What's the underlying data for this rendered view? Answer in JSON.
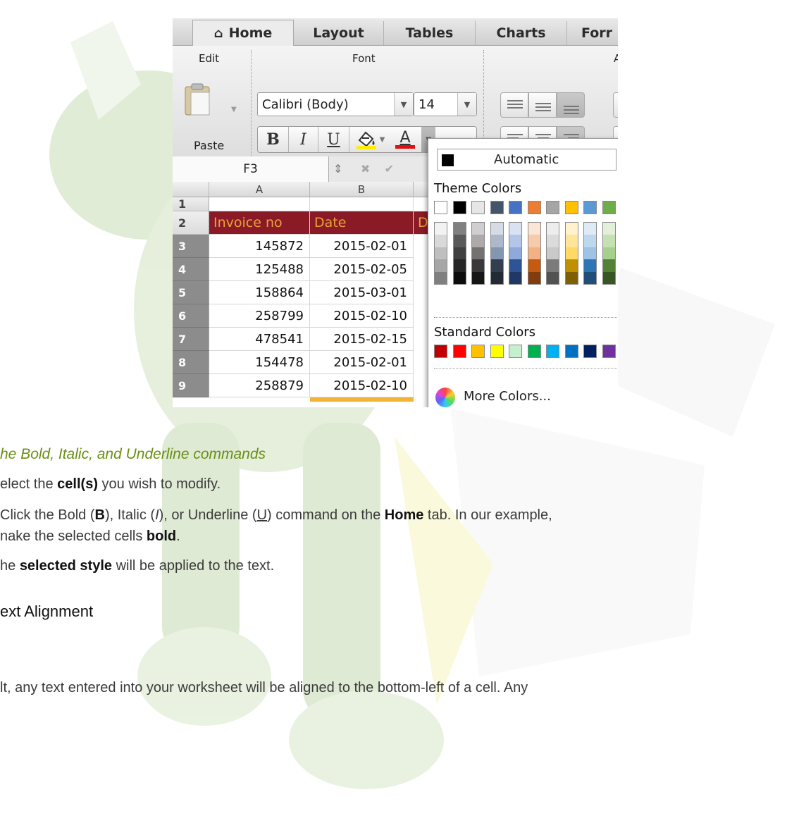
{
  "ribbon": {
    "tabs": [
      "Home",
      "Layout",
      "Tables",
      "Charts",
      "Forr"
    ],
    "groups": {
      "edit": "Edit",
      "font": "Font",
      "alignment_cut": "A"
    },
    "paste_label": "Paste",
    "font_name": "Calibri (Body)",
    "font_size": "14",
    "bold_label": "B",
    "italic_label": "I",
    "underline_label": "U",
    "highlight_color": "#ffee00",
    "font_color": "#e01010",
    "font_color_glyph": "A"
  },
  "namebox": "F3",
  "sheet": {
    "columns": [
      "A",
      "B"
    ],
    "row_numbers": [
      "1",
      "2",
      "3",
      "4",
      "5",
      "6",
      "7",
      "8",
      "9"
    ],
    "header_row": {
      "col_a": "Invoice no",
      "col_b": "Date",
      "col_c_cut": "D"
    },
    "rows": [
      {
        "invoice": "145872",
        "date": "2015-02-01"
      },
      {
        "invoice": "125488",
        "date": "2015-02-05"
      },
      {
        "invoice": "158864",
        "date": "2015-03-01"
      },
      {
        "invoice": "258799",
        "date": "2015-02-10"
      },
      {
        "invoice": "478541",
        "date": "2015-02-15"
      },
      {
        "invoice": "154478",
        "date": "2015-02-01"
      },
      {
        "invoice": "258879",
        "date": "2015-02-10"
      }
    ],
    "header_fill": "#8b1a27",
    "header_text_color": "#e8a33a"
  },
  "color_popup": {
    "automatic_label": "Automatic",
    "theme_label": "Theme Colors",
    "standard_label": "Standard Colors",
    "more_label": "More Colors...",
    "theme_top": [
      "#ffffff",
      "#000000",
      "#e7e6e6",
      "#44546a",
      "#4472c4",
      "#ed7d31",
      "#a5a5a5",
      "#ffc000",
      "#5b9bd5",
      "#70ad47"
    ],
    "theme_shades": [
      [
        "#f2f2f2",
        "#d9d9d9",
        "#bfbfbf",
        "#a6a6a6",
        "#808080"
      ],
      [
        "#808080",
        "#595959",
        "#404040",
        "#262626",
        "#0d0d0d"
      ],
      [
        "#d0cece",
        "#aeaaaa",
        "#757171",
        "#3a3838",
        "#171616"
      ],
      [
        "#d6dce4",
        "#adb9ca",
        "#8497b0",
        "#333f4f",
        "#222a35"
      ],
      [
        "#d9e2f3",
        "#b4c6e7",
        "#8eaadb",
        "#2f5496",
        "#1f3864"
      ],
      [
        "#fbe5d5",
        "#f7caac",
        "#f4b183",
        "#c55a11",
        "#833c0b"
      ],
      [
        "#ededed",
        "#dbdbdb",
        "#c9c9c9",
        "#7b7b7b",
        "#525252"
      ],
      [
        "#fff2cc",
        "#fee599",
        "#ffd966",
        "#bf9000",
        "#7f6000"
      ],
      [
        "#deebf6",
        "#bdd7ee",
        "#9dc3e6",
        "#2e75b5",
        "#1f4e79"
      ],
      [
        "#e2efd9",
        "#c5e0b3",
        "#a8d08d",
        "#538135",
        "#375623"
      ]
    ],
    "standard": [
      "#c00000",
      "#ff0000",
      "#ffc000",
      "#ffff00",
      "#c6efce",
      "#00b050",
      "#00b0f0",
      "#0070c0",
      "#002060",
      "#7030a0"
    ]
  },
  "doc": {
    "subhead": "he Bold, Italic, and Underline commands",
    "step1": {
      "t1": "elect the ",
      "b1": "cell(s)",
      "t2": " you wish to modify."
    },
    "step2": {
      "t1": "Click the Bold (",
      "b1": "B",
      "t2": "), Italic (",
      "i1": "I",
      "t3": "), or Underline (",
      "u1": "U",
      "t4": ") command on the ",
      "b2": "Home",
      "t5": " tab. In our example,",
      "line2a": "nake the selected cells ",
      "line2b": "bold",
      "line2c": "."
    },
    "step3": {
      "t1": "he ",
      "b1": "selected style",
      "t2": " will be applied to the text."
    },
    "heading": "ext Alignment",
    "para": "lt, any text entered into your worksheet will be aligned to the bottom-left of a cell. Any"
  }
}
